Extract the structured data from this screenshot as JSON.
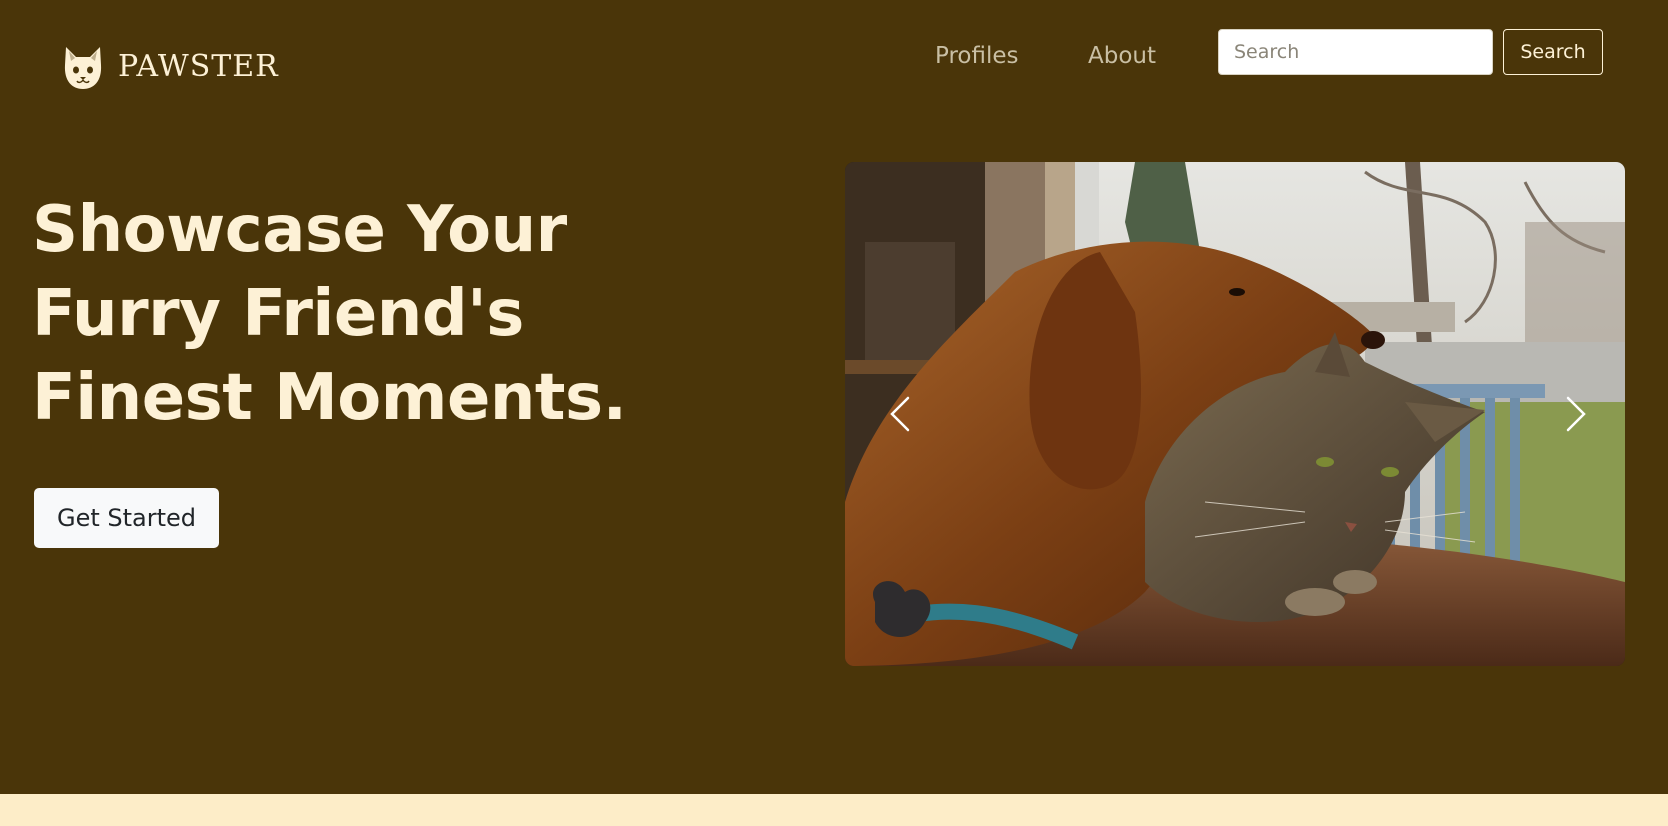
{
  "navbar": {
    "brand": "PAWSTER",
    "brand_icon": "cat-face-icon",
    "links": [
      {
        "label": "Profiles"
      },
      {
        "label": "About"
      }
    ],
    "search": {
      "placeholder": "Search",
      "value": "",
      "button_label": "Search"
    }
  },
  "hero": {
    "title_lines": [
      "Showcase Your",
      "Furry Friend's",
      "Finest Moments."
    ],
    "cta_label": "Get Started"
  },
  "carousel": {
    "image_description_icon": "dog-and-cat-photo",
    "prev_icon": "chevron-left-icon",
    "next_icon": "chevron-right-icon"
  },
  "colors": {
    "background": "#4a3509",
    "accent_text": "#fdf1d6",
    "nav_link": "#c9bfa4",
    "bottom_band": "#fdedc8"
  }
}
